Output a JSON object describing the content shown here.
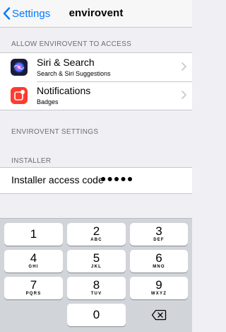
{
  "nav": {
    "back_label": "Settings",
    "title": "envirovent"
  },
  "sections": {
    "access_header": "ALLOW ENVIROVENT TO ACCESS",
    "settings_header": "ENVIROVENT SETTINGS",
    "installer_header": "INSTALLER"
  },
  "access_items": [
    {
      "title": "Siri & Search",
      "subtitle": "Search & Siri Suggestions",
      "icon": "siri-icon"
    },
    {
      "title": "Notifications",
      "subtitle": "Badges",
      "icon": "notifications-icon"
    }
  ],
  "installer": {
    "label": "Installer access code",
    "value": "●●●●●"
  },
  "keypad": {
    "keys": [
      {
        "num": "1",
        "letters": ""
      },
      {
        "num": "2",
        "letters": "ABC"
      },
      {
        "num": "3",
        "letters": "DEF"
      },
      {
        "num": "4",
        "letters": "GHI"
      },
      {
        "num": "5",
        "letters": "JKL"
      },
      {
        "num": "6",
        "letters": "MNO"
      },
      {
        "num": "7",
        "letters": "PQRS"
      },
      {
        "num": "8",
        "letters": "TUV"
      },
      {
        "num": "9",
        "letters": "WXYZ"
      },
      {
        "num": "0",
        "letters": ""
      }
    ],
    "delete_icon": "backspace-icon"
  },
  "colors": {
    "accent": "#007aff",
    "siri": "#1c1c3a",
    "notifications": "#ff3b30"
  }
}
